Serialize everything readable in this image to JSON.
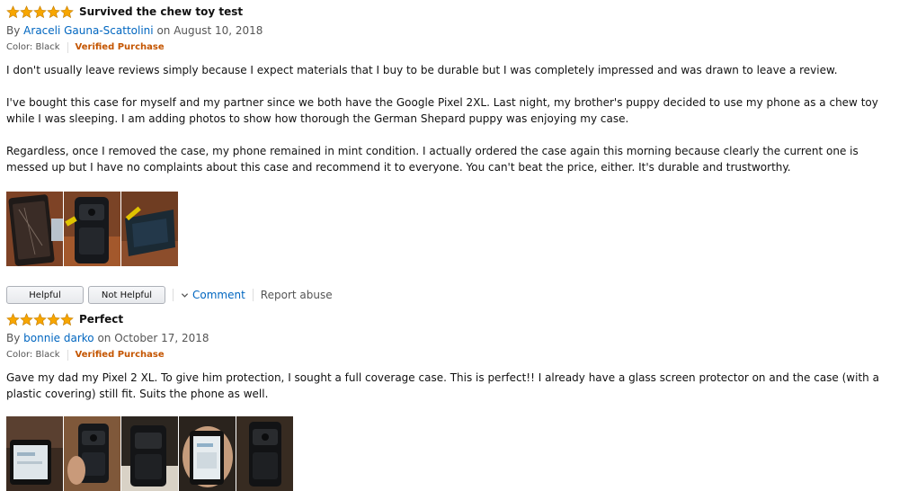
{
  "reviews": [
    {
      "rating": 5,
      "title": "Survived the chew toy test",
      "by": "By",
      "author": "Araceli Gauna-Scattolini",
      "date": "on August 10, 2018",
      "color": "Color: Black",
      "verified": "Verified Purchase",
      "paragraphs": [
        "I don't usually leave reviews simply because I expect materials that I buy to be durable but I was completely impressed and was drawn to leave a review.",
        "I've bought this case for myself and my partner since we both have the Google Pixel 2XL. Last night, my brother's puppy decided to use my phone as a chew toy while I was sleeping. I am adding photos to show how thorough the German Shepard puppy was enjoying my case.",
        "Regardless, once I removed the case, my phone remained in mint condition. I actually ordered the case again this morning because clearly the current one is messed up but I have no complaints about this case and recommend it to everyone. You can't beat the price, either. It's durable and trustworthy."
      ],
      "photos": [
        "photo-1",
        "photo-2",
        "photo-3"
      ],
      "actions": {
        "helpful": "Helpful",
        "not_helpful": "Not Helpful",
        "comment": "Comment",
        "report": "Report abuse"
      }
    },
    {
      "rating": 5,
      "title": "Perfect",
      "by": "By",
      "author": "bonnie darko",
      "date": "on October 17, 2018",
      "color": "Color: Black",
      "verified": "Verified Purchase",
      "paragraphs": [
        "Gave my dad my Pixel 2 XL. To give him protection, I sought a full coverage case. This is perfect!! I already have a glass screen protector on and the case (with a plastic covering) still fit. Suits the phone as well."
      ],
      "photos": [
        "photo-1",
        "photo-2",
        "photo-3",
        "photo-4",
        "photo-5"
      ]
    }
  ],
  "colors": {
    "star": "#f7a600",
    "link": "#0066c0",
    "verified": "#c45500"
  }
}
